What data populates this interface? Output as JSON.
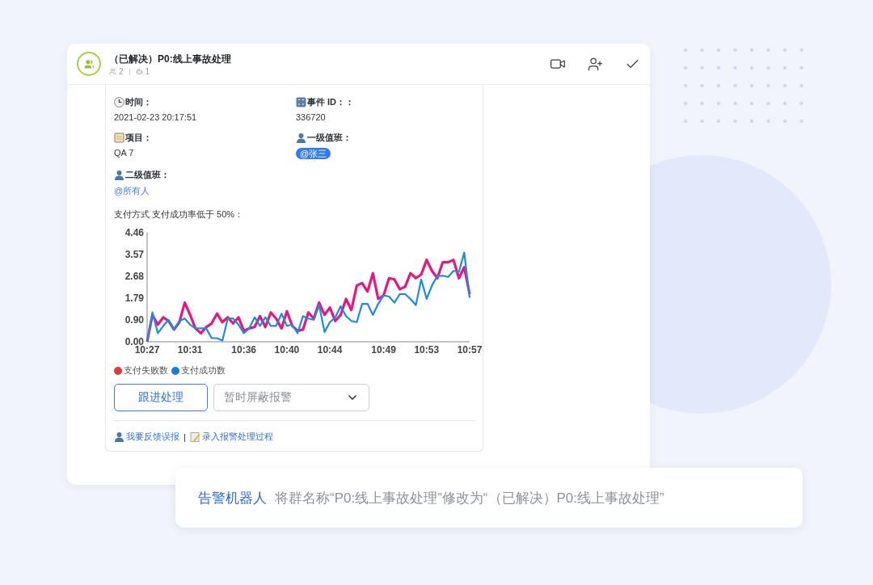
{
  "chat": {
    "title": "（已解决）P0:线上事故处理",
    "member_count": "2",
    "bot_count": "1"
  },
  "message": {
    "fields": [
      {
        "label": "时间：",
        "value": "2021-02-23 20:17:51",
        "kind": "text"
      },
      {
        "label": "事件 ID：：",
        "value": "336720",
        "kind": "text"
      },
      {
        "label": "项目：",
        "value": "QA 7",
        "kind": "text"
      },
      {
        "label": "一级值班：",
        "value": "@张三",
        "kind": "pill"
      },
      {
        "label": "二级值班：",
        "value": "@所有人",
        "kind": "mention"
      }
    ],
    "caption": "支付方式 支付成功率低于 50%：",
    "chart": {
      "chart_data": {
        "type": "line",
        "x": [
          627,
          627.5,
          628,
          628.5,
          629,
          629.5,
          630,
          630.5,
          631,
          631.5,
          632,
          632.5,
          633,
          633.5,
          634,
          634.5,
          635,
          635.5,
          636,
          636.5,
          637,
          637.5,
          638,
          638.5,
          639,
          639.5,
          640,
          640.5,
          641,
          641.5,
          642,
          642.5,
          643,
          643.5,
          644,
          644.5,
          645,
          645.5,
          646,
          646.5,
          647,
          647.5,
          648,
          648.5,
          649,
          649.5,
          650,
          650.5,
          651,
          651.5,
          652,
          652.5,
          653,
          653.5,
          654,
          654.5,
          655,
          655.5,
          656,
          656.5,
          657
        ],
        "xlim": [
          627,
          657
        ],
        "ylim": [
          0,
          4.46
        ],
        "xticks": [
          {
            "value": 627,
            "label": "10:27"
          },
          {
            "value": 631,
            "label": "10:31"
          },
          {
            "value": 636,
            "label": "10:36"
          },
          {
            "value": 640,
            "label": "10:40"
          },
          {
            "value": 644,
            "label": "10:44"
          },
          {
            "value": 649,
            "label": "10:49"
          },
          {
            "value": 653,
            "label": "10:53"
          },
          {
            "value": 657,
            "label": "10:57"
          }
        ],
        "yticks": [
          {
            "value": 0,
            "label": "0.00"
          },
          {
            "value": 0.9,
            "label": "0.90"
          },
          {
            "value": 1.79,
            "label": "1.79"
          },
          {
            "value": 2.68,
            "label": "2.68"
          },
          {
            "value": 3.57,
            "label": "3.57"
          },
          {
            "value": 4.46,
            "label": "4.46"
          }
        ],
        "series": [
          {
            "color": "#e8167f",
            "values": [
              0,
              1.1,
              0.7,
              1.0,
              0.85,
              0.5,
              0.8,
              1.6,
              1.1,
              0.55,
              0.35,
              0.6,
              0.75,
              1.15,
              0.8,
              1.0,
              0.75,
              1.0,
              0.45,
              0.55,
              0.6,
              1.05,
              0.6,
              1.2,
              0.95,
              0.55,
              1.25,
              0.65,
              0.45,
              0.5,
              1.2,
              0.95,
              1.6,
              1.1,
              1.4,
              0.85,
              1.1,
              1.75,
              1.3,
              2.3,
              2.4,
              2.05,
              2.8,
              1.75,
              1.9,
              2.6,
              2.55,
              2.15,
              2.25,
              2.8,
              2.6,
              2.75,
              3.35,
              2.9,
              2.6,
              3.25,
              3.25,
              3.35,
              2.6,
              3.05,
              1.95
            ]
          },
          {
            "color": "#1c8ae6",
            "values": [
              0,
              1.2,
              0.35,
              0.65,
              0.9,
              0.5,
              0.85,
              0.95,
              0.7,
              0.55,
              0.55,
              0.55,
              0.15,
              0.15,
              0.05,
              0.95,
              0.95,
              0.7,
              0.35,
              0.55,
              1.0,
              0.65,
              1.0,
              0.65,
              0.65,
              1.15,
              0.65,
              0.7,
              0.35,
              1.05,
              0.95,
              0.9,
              1.5,
              0.4,
              0.8,
              1.0,
              1.45,
              1.05,
              0.85,
              0.8,
              1.55,
              1.55,
              1.1,
              1.55,
              1.9,
              1.85,
              1.6,
              1.95,
              1.95,
              1.75,
              1.5,
              2.55,
              1.75,
              2.3,
              2.7,
              2.7,
              2.65,
              2.9,
              2.85,
              3.65,
              1.8
            ]
          }
        ]
      }
    },
    "legend": [
      {
        "label": "支付失败数",
        "color": "#e53935"
      },
      {
        "label": "支付成功数",
        "color": "#1e7be0"
      }
    ],
    "follow_button": "跟进处理",
    "mute_select": {
      "placeholder": "暂时屏蔽报警"
    },
    "links": [
      {
        "label": "我要反馈误报"
      },
      {
        "label": "录入报警处理过程"
      }
    ],
    "link_separator": "|"
  },
  "notice": {
    "sender": "告警机器人",
    "text": "将群名称“P0:线上事故处理”修改为“（已解决）P0:线上事故处理”"
  }
}
